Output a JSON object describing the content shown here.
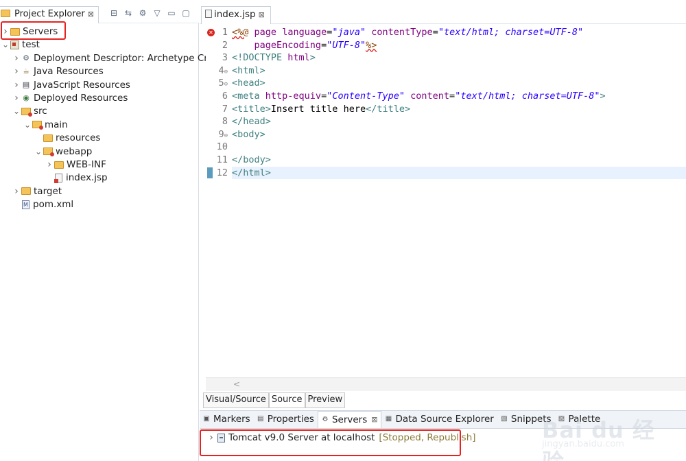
{
  "project_explorer": {
    "tab_label": "Project Explorer",
    "close_symbol": "⊠",
    "toolbar_icons": [
      "collapse-all-icon",
      "link-with-editor-icon",
      "filter-icon",
      "view-menu-icon",
      "minimize-icon",
      "maximize-icon"
    ],
    "toolbar_glyphs": [
      "⊟",
      "⇆",
      "⚙",
      "▽",
      "▭",
      "▢"
    ],
    "tree": [
      {
        "label": "Servers",
        "icon": "folder-icon",
        "expanded": false,
        "depth": 0
      },
      {
        "label": "test",
        "icon": "project-icon",
        "expanded": true,
        "depth": 0
      },
      {
        "label": "Deployment Descriptor: Archetype Cre",
        "icon": "deployment-descriptor-icon",
        "expanded": false,
        "depth": 1
      },
      {
        "label": "Java Resources",
        "icon": "java-resources-icon",
        "expanded": false,
        "depth": 1
      },
      {
        "label": "JavaScript Resources",
        "icon": "javascript-resources-icon",
        "expanded": false,
        "depth": 1
      },
      {
        "label": "Deployed Resources",
        "icon": "deployed-resources-icon",
        "expanded": false,
        "depth": 1
      },
      {
        "label": "src",
        "icon": "source-folder-icon",
        "expanded": true,
        "depth": 1
      },
      {
        "label": "main",
        "icon": "source-folder-icon",
        "expanded": true,
        "depth": 2
      },
      {
        "label": "resources",
        "icon": "folder-icon",
        "expanded": null,
        "depth": 3
      },
      {
        "label": "webapp",
        "icon": "source-folder-icon",
        "expanded": true,
        "depth": 3
      },
      {
        "label": "WEB-INF",
        "icon": "folder-icon",
        "expanded": false,
        "depth": 4
      },
      {
        "label": "index.jsp",
        "icon": "jsp-file-icon",
        "expanded": null,
        "depth": 4
      },
      {
        "label": "target",
        "icon": "folder-icon",
        "expanded": false,
        "depth": 1
      },
      {
        "label": "pom.xml",
        "icon": "xml-file-icon",
        "expanded": null,
        "depth": 1
      }
    ]
  },
  "editor": {
    "tab_label": "index.jsp",
    "close_symbol": "⊠",
    "lines": [
      {
        "num": "1",
        "fold": "",
        "tokens": [
          {
            "t": "dir",
            "v": "<%@"
          },
          {
            "t": "text",
            "v": " "
          },
          {
            "t": "attr",
            "v": "page"
          },
          {
            "t": "text",
            "v": " "
          },
          {
            "t": "attr",
            "v": "language"
          },
          {
            "t": "text",
            "v": "="
          },
          {
            "t": "val",
            "v": "\"java\""
          },
          {
            "t": "text",
            "v": " "
          },
          {
            "t": "attr",
            "v": "contentType"
          },
          {
            "t": "text",
            "v": "="
          },
          {
            "t": "val",
            "v": "\"text/html; charset=UTF-8\""
          }
        ]
      },
      {
        "num": "2",
        "fold": "",
        "tokens": [
          {
            "t": "text",
            "v": "    "
          },
          {
            "t": "attr",
            "v": "pageEncoding"
          },
          {
            "t": "text",
            "v": "="
          },
          {
            "t": "val",
            "v": "\"UTF-8\""
          },
          {
            "t": "dir",
            "v": "%>"
          }
        ]
      },
      {
        "num": "3",
        "fold": "",
        "tokens": [
          {
            "t": "doctype",
            "v": "<!DOCTYPE "
          },
          {
            "t": "attr",
            "v": "html"
          },
          {
            "t": "doctype",
            "v": ">"
          }
        ]
      },
      {
        "num": "4",
        "fold": "⊖",
        "tokens": [
          {
            "t": "tag",
            "v": "<html>"
          }
        ]
      },
      {
        "num": "5",
        "fold": "⊖",
        "tokens": [
          {
            "t": "tag",
            "v": "<head>"
          }
        ]
      },
      {
        "num": "6",
        "fold": "",
        "tokens": [
          {
            "t": "tag",
            "v": "<meta"
          },
          {
            "t": "text",
            "v": " "
          },
          {
            "t": "attr",
            "v": "http-equiv"
          },
          {
            "t": "text",
            "v": "="
          },
          {
            "t": "val",
            "v": "\"Content-Type\""
          },
          {
            "t": "text",
            "v": " "
          },
          {
            "t": "attr",
            "v": "content"
          },
          {
            "t": "text",
            "v": "="
          },
          {
            "t": "val",
            "v": "\"text/html; charset=UTF-8\""
          },
          {
            "t": "tag",
            "v": ">"
          }
        ]
      },
      {
        "num": "7",
        "fold": "",
        "tokens": [
          {
            "t": "tag",
            "v": "<title>"
          },
          {
            "t": "text",
            "v": "Insert title here"
          },
          {
            "t": "tag",
            "v": "</title>"
          }
        ]
      },
      {
        "num": "8",
        "fold": "",
        "tokens": [
          {
            "t": "tag",
            "v": "</head>"
          }
        ]
      },
      {
        "num": "9",
        "fold": "⊖",
        "tokens": [
          {
            "t": "tag",
            "v": "<body>"
          }
        ]
      },
      {
        "num": "10",
        "fold": "",
        "tokens": []
      },
      {
        "num": "11",
        "fold": "",
        "tokens": [
          {
            "t": "tag",
            "v": "</body>"
          }
        ]
      },
      {
        "num": "12",
        "fold": "",
        "tokens": [
          {
            "t": "tag",
            "v": "</html>"
          }
        ]
      }
    ],
    "error_line": "1",
    "current_line": "12",
    "scroll_left_arrow": "<",
    "source_tabs": [
      "Visual/Source",
      "Source",
      "Preview"
    ],
    "active_source_tab": "Source"
  },
  "bottom_panel": {
    "tabs": [
      {
        "label": "Markers",
        "icon": "markers-icon",
        "glyph": "▣"
      },
      {
        "label": "Properties",
        "icon": "properties-icon",
        "glyph": "▤"
      },
      {
        "label": "Servers",
        "icon": "servers-icon",
        "glyph": "⚙",
        "active": true,
        "close": "⊠"
      },
      {
        "label": "Data Source Explorer",
        "icon": "data-source-icon",
        "glyph": "▦"
      },
      {
        "label": "Snippets",
        "icon": "snippets-icon",
        "glyph": "▧"
      },
      {
        "label": "Palette",
        "icon": "palette-icon",
        "glyph": "▨"
      }
    ],
    "servers": [
      {
        "name": "Tomcat v9.0 Server at localhost",
        "status": "[Stopped, Republish]"
      }
    ]
  },
  "watermark": {
    "text": "Bai du 经验",
    "url": "jingyan.baidu.com"
  },
  "colors": {
    "highlight": "#e5221f",
    "tag": "#3f7f7f",
    "attr": "#7f007f",
    "value": "#2a00ff",
    "current_line": "#e8f2fe",
    "error": "#d7281e"
  }
}
